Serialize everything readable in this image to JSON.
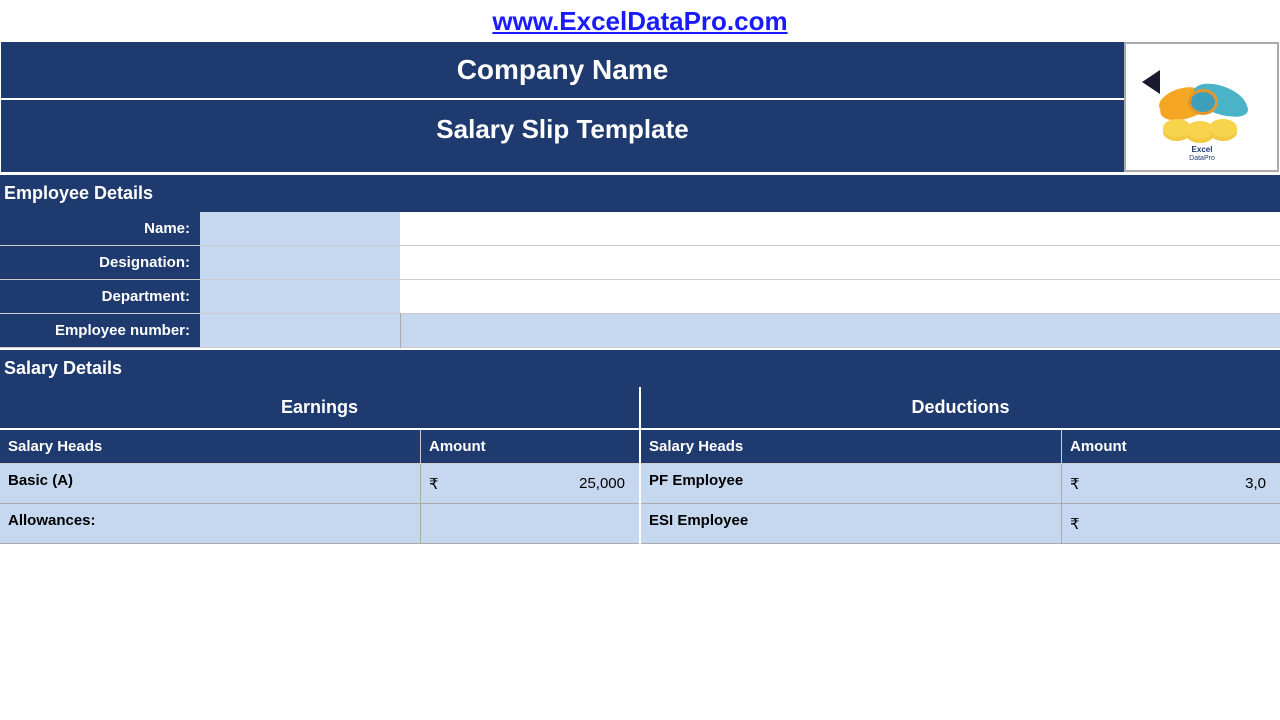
{
  "site": {
    "url": "www.ExcelDataPro.com"
  },
  "header": {
    "company_name": "Company Name",
    "document_title": "Salary Slip Template"
  },
  "sections": {
    "employee_details_label": "Employee Details",
    "salary_details_label": "Salary Details"
  },
  "employee_fields": [
    {
      "label": "Name:",
      "value": ""
    },
    {
      "label": "Designation:",
      "value": ""
    },
    {
      "label": "Department:",
      "value": ""
    },
    {
      "label": "Employee number:",
      "value_narrow": "",
      "value_wide": ""
    }
  ],
  "earnings": {
    "col_header": "Earnings",
    "sub_heads_label": "Salary Heads",
    "sub_amount_label": "Amount",
    "rows": [
      {
        "head": "Basic (A)",
        "currency": "₹",
        "amount": "25,000"
      },
      {
        "head": "Allowances:",
        "currency": "",
        "amount": ""
      }
    ]
  },
  "deductions": {
    "col_header": "Deductions",
    "sub_heads_label": "Salary Heads",
    "sub_amount_label": "Amount",
    "rows": [
      {
        "head": "PF Employee",
        "currency": "₹",
        "amount": "3,0"
      },
      {
        "head": "ESI Employee",
        "currency": "₹",
        "amount": ""
      }
    ]
  }
}
